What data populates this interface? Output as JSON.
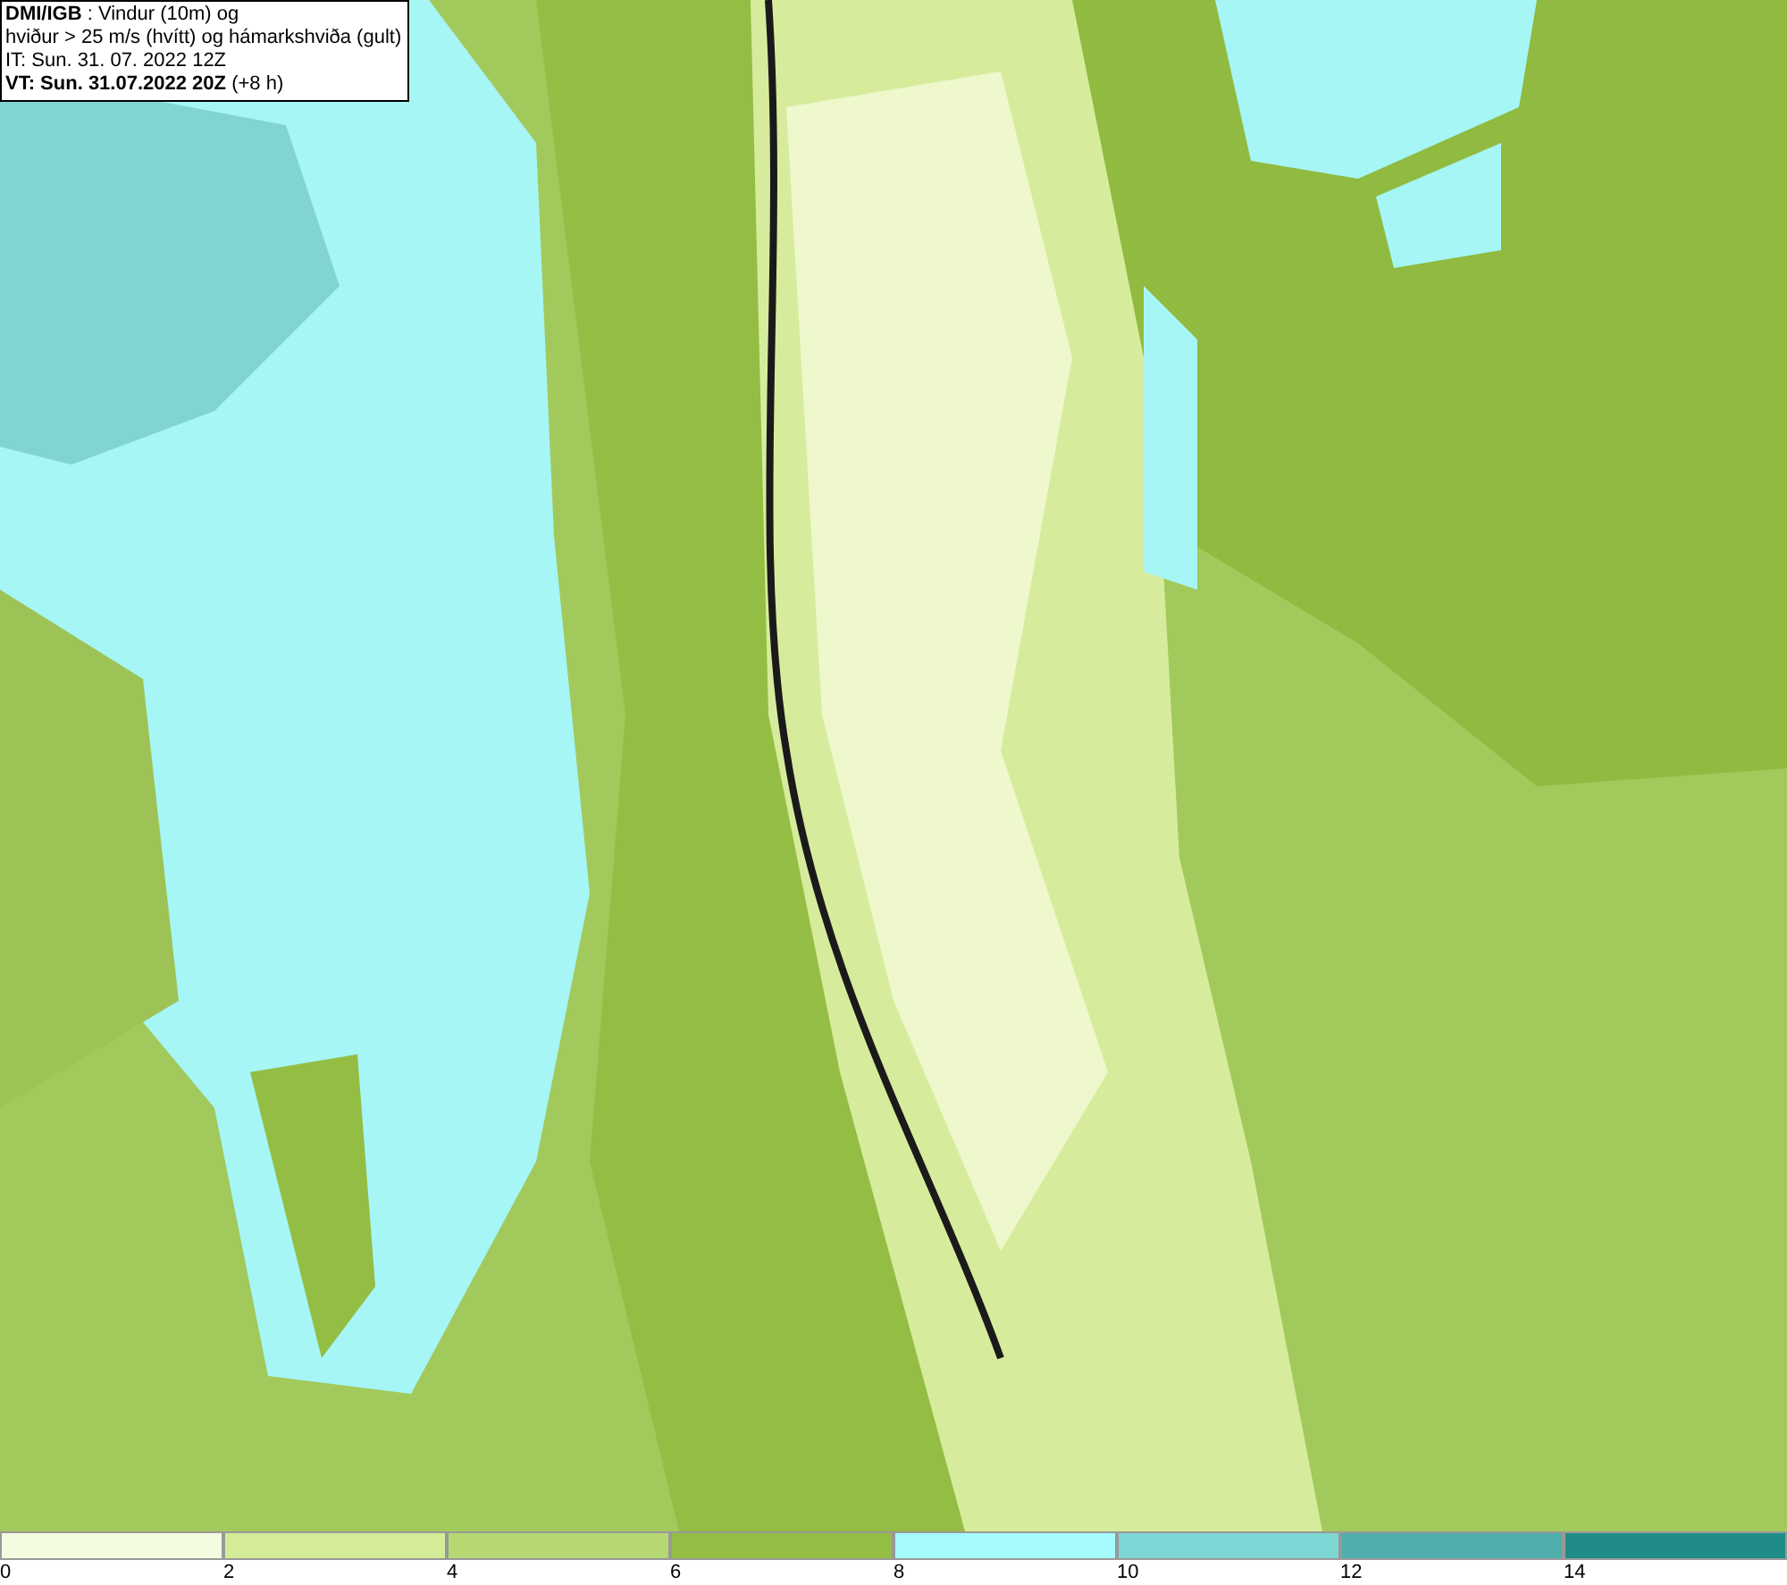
{
  "info_box": {
    "lines": [
      "**DMI/IGB** : Vindur (10m) og",
      "hviður > 25 m/s (hvítt) og hámarkshviða (gult)",
      "IT: Sun. 31. 07. 2022 12Z",
      "**VT: Sun. 31.07.2022 20Z** (+8 h)"
    ]
  },
  "legend": [
    {
      "label": "0",
      "color": "#f4fce0"
    },
    {
      "label": "2",
      "color": "#d4ec98"
    },
    {
      "label": "4",
      "color": "#b6d873"
    },
    {
      "label": "6",
      "color": "#94bd44"
    },
    {
      "label": "8",
      "color": "#a6fcfc"
    },
    {
      "label": "10",
      "color": "#7ed6d4"
    },
    {
      "label": "12",
      "color": "#50aeac"
    },
    {
      "label": "14",
      "color": "#208c88"
    }
  ]
}
